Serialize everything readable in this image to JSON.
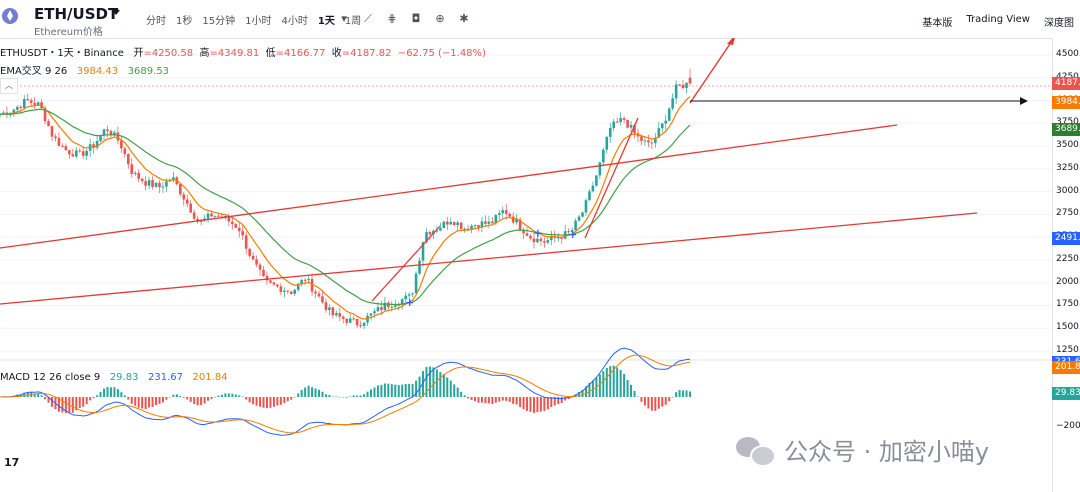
{
  "header": {
    "symbol": "ETH/USDT",
    "subtitle": "Ethereum价格",
    "intervals": [
      "分时",
      "1秒",
      "15分钟",
      "1小时",
      "4小时",
      "1天",
      "1周"
    ],
    "active_interval": "1天",
    "right_tabs": [
      "基本版",
      "Trading View",
      "深度图"
    ]
  },
  "legend": {
    "pair_label": "ETHUSDT・1天・Binance",
    "open_label": "开",
    "open": "=4250.58",
    "high_label": "高",
    "high": "=4349.81",
    "low_label": "低",
    "low": "=4166.77",
    "close_label": "收",
    "close": "=4187.82",
    "change": "−62.75 (−1.48%)",
    "ema_label": "EMA交叉 9 26",
    "ema_fast": "3984.43",
    "ema_slow": "3689.53",
    "collapse_icon": "chevron-up-icon"
  },
  "macd_legend": {
    "label": "MACD 12 26 close 9",
    "hist": "29.83",
    "macd": "231.67",
    "signal": "201.84"
  },
  "price_axis": {
    "ticks": [
      "4500.00",
      "4250.00",
      "4000.00",
      "3750.00",
      "3500.00",
      "3250.00",
      "3000.00",
      "2750.00",
      "2500.00",
      "2250.00",
      "2000.00",
      "1750.00",
      "1500.00",
      "1250.00"
    ],
    "tags": [
      {
        "text": "4187.82",
        "color": "#ef5350"
      },
      {
        "text": "3984.43",
        "color": "#f57c00"
      },
      {
        "text": "3689.53",
        "color": "#2e7d32"
      },
      {
        "text": "2491.61",
        "color": "#2962ff"
      }
    ],
    "macd_ticks": [
      "0.00",
      "−200.00"
    ],
    "macd_tags": [
      {
        "text": "231.67",
        "color": "#2962ff"
      },
      {
        "text": "201.84",
        "color": "#f57c00"
      },
      {
        "text": "29.83",
        "color": "#26a69a"
      }
    ]
  },
  "watermark": {
    "text": "公众号 · 加密小喵y"
  },
  "colors": {
    "up": "#26a69a",
    "down": "#ef5350",
    "ema_fast": "#f57c00",
    "ema_slow": "#43a047",
    "macd": "#2962ff",
    "signal": "#f57c00",
    "trendline": "#e53935",
    "hline": "#131722",
    "accent": "#2962ff"
  },
  "chart_data": {
    "type": "candlestick",
    "interval": "1天",
    "ylim": [
      1250,
      4500
    ],
    "series": [
      {
        "name": "EMA 9",
        "color": "#f57c00"
      },
      {
        "name": "EMA 26",
        "color": "#43a047"
      }
    ],
    "candles_approx_close": [
      3850,
      3900,
      4000,
      3950,
      3600,
      3450,
      3400,
      3500,
      3700,
      3550,
      3200,
      3100,
      3050,
      3150,
      2900,
      2650,
      2750,
      2700,
      2600,
      2250,
      2000,
      1950,
      1900,
      2050,
      1850,
      1650,
      1600,
      1550,
      1650,
      1750,
      1800,
      1850,
      2550,
      2600,
      2700,
      2600,
      2650,
      2650,
      2800,
      2650,
      2500,
      2450,
      2500,
      2550,
      2800,
      3200,
      3700,
      3800,
      3600,
      3500,
      3750,
      4150,
      4187.82
    ],
    "last": {
      "open": 4250.58,
      "high": 4349.81,
      "low": 4166.77,
      "close": 4187.82
    },
    "ema_fast_last": 3984.43,
    "ema_slow_last": 3689.53,
    "horizontal_line": 3984.43,
    "marked_level": 2491.61,
    "macd": {
      "params": "12 26 close 9",
      "hist": 29.83,
      "macd": 231.67,
      "signal": 201.84
    }
  }
}
